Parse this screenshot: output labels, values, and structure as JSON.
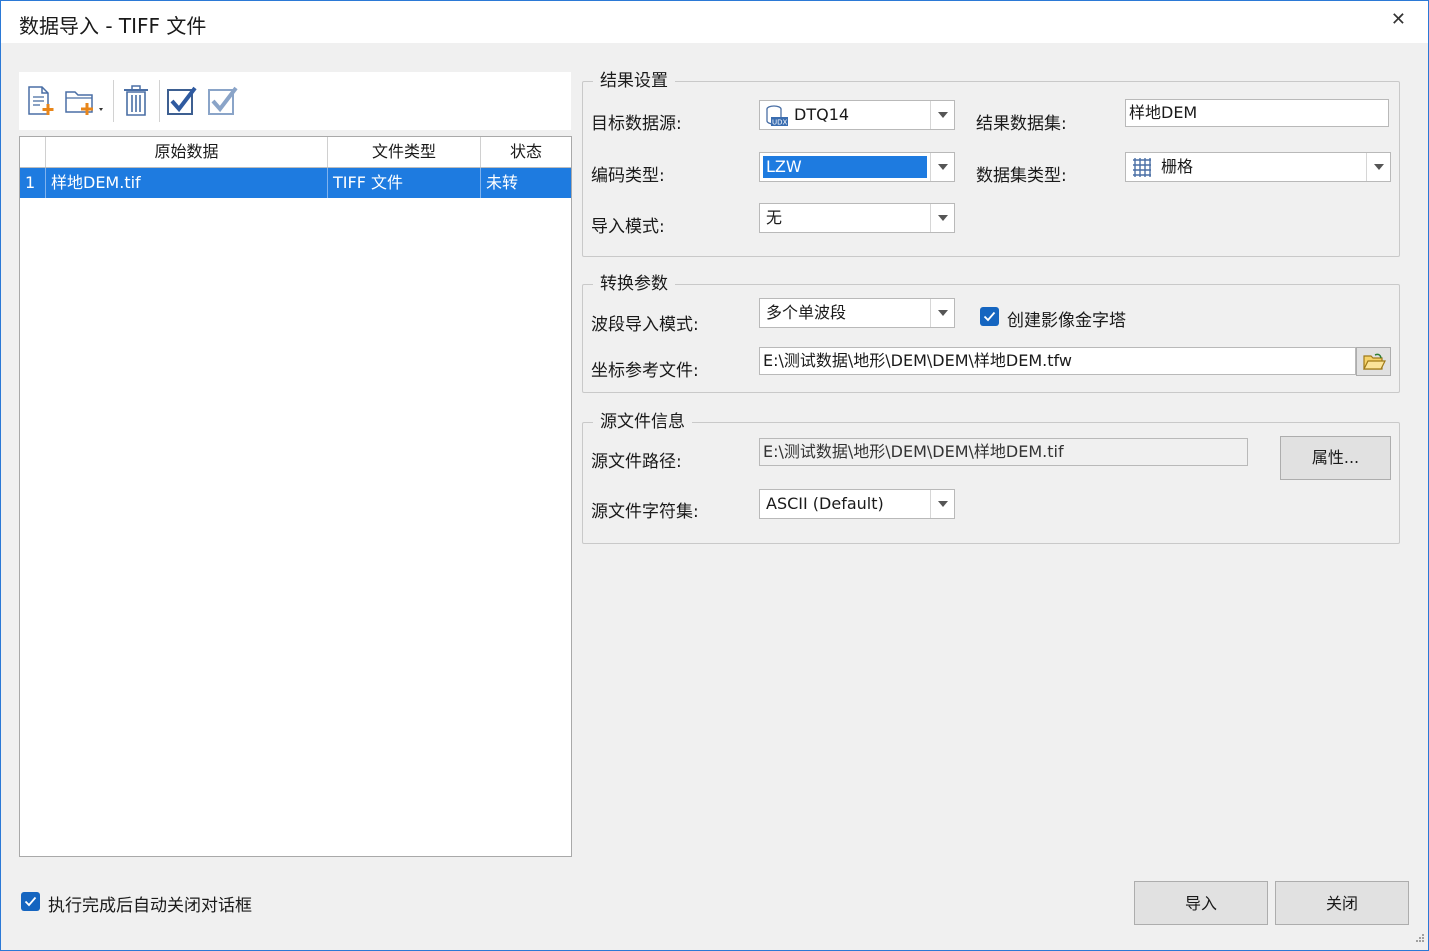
{
  "window": {
    "title": "数据导入 - TIFF 文件",
    "close_glyph": "✕"
  },
  "toolbar": {
    "icons": [
      "add-file-icon",
      "add-folder-icon",
      "delete-icon",
      "select-all-icon",
      "select-invert-icon"
    ]
  },
  "grid": {
    "columns": [
      "原始数据",
      "文件类型",
      "状态"
    ],
    "rows": [
      {
        "index": "1",
        "source": "样地DEM.tif",
        "type": "TIFF 文件",
        "status": "未转"
      }
    ]
  },
  "result_settings": {
    "legend": "结果设置",
    "target_datasource_label": "目标数据源:",
    "target_datasource_value": "DTQ14",
    "result_dataset_label": "结果数据集:",
    "result_dataset_value": "样地DEM",
    "encoding_label": "编码类型:",
    "encoding_value": "LZW",
    "dataset_type_label": "数据集类型:",
    "dataset_type_value": "栅格",
    "import_mode_label": "导入模式:",
    "import_mode_value": "无"
  },
  "conversion": {
    "legend": "转换参数",
    "band_mode_label": "波段导入模式:",
    "band_mode_value": "多个单波段",
    "pyramid_label": "创建影像金字塔",
    "pyramid_checked": true,
    "coord_file_label": "坐标参考文件:",
    "coord_file_value": "E:\\测试数据\\地形\\DEM\\DEM\\样地DEM.tfw"
  },
  "source_info": {
    "legend": "源文件信息",
    "path_label": "源文件路径:",
    "path_value": "E:\\测试数据\\地形\\DEM\\DEM\\样地DEM.tif",
    "properties_button": "属性...",
    "charset_label": "源文件字符集:",
    "charset_value": "ASCII (Default)"
  },
  "footer": {
    "auto_close_label": "执行完成后自动关闭对话框",
    "auto_close_checked": true,
    "import_button": "导入",
    "close_button": "关闭"
  },
  "colors": {
    "accent": "#1e7be0",
    "checkbox": "#1565c0"
  }
}
